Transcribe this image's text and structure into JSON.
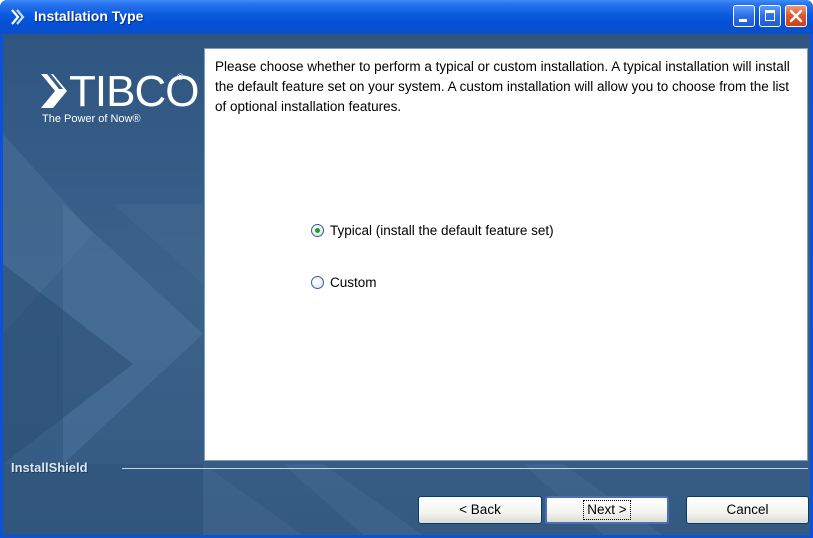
{
  "window": {
    "title": "Installation Type",
    "colors": {
      "titlebar": "#0a5ae0",
      "client": "#3a5f86",
      "radio_selected": "#21a121"
    }
  },
  "brand": {
    "name": "TIBCO",
    "registered": "®",
    "tagline": "The Power of Now®"
  },
  "content": {
    "instructions": "Please choose whether to perform a typical or custom installation.  A typical installation will install the default feature set on your system.  A custom installation will allow you to choose from the list of optional installation features.",
    "options": [
      {
        "label": "Typical (install the default feature set)",
        "selected": true
      },
      {
        "label": "Custom",
        "selected": false
      }
    ]
  },
  "footer": {
    "vendor": "InstallShield",
    "buttons": {
      "back": "< Back",
      "next": "Next >",
      "cancel": "Cancel"
    }
  }
}
